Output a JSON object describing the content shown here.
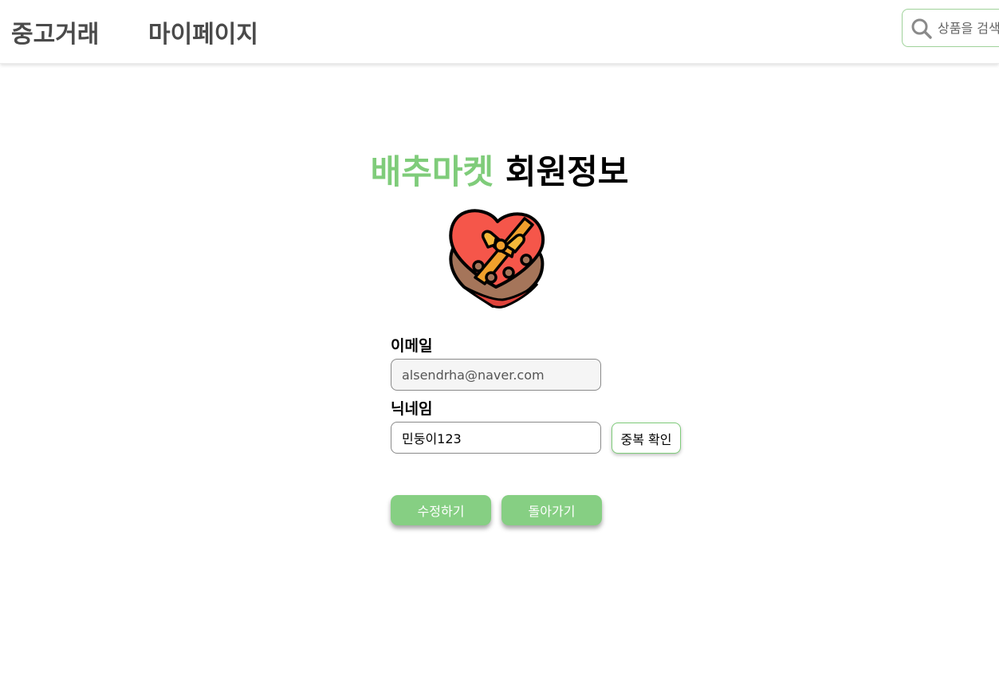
{
  "header": {
    "nav": {
      "trade_label": "중고거래",
      "mypage_label": "마이페이지"
    },
    "search": {
      "placeholder": "상품을 검색"
    }
  },
  "main": {
    "title": {
      "brand": "배추마켓",
      "rest": "회원정보"
    },
    "profile_image": {
      "icon": "heart-gift-box-icon"
    },
    "form": {
      "email_label": "이메일",
      "email_value": "alsendrha@naver.com",
      "nickname_label": "닉네임",
      "nickname_value": "민둥이123",
      "duplicate_check_label": "중복 확인"
    },
    "actions": {
      "edit_label": "수정하기",
      "back_label": "돌아가기"
    }
  },
  "colors": {
    "accent_green": "#86cf83",
    "brand_green": "#7fcc7a",
    "nav_text": "#4a4a4a"
  }
}
